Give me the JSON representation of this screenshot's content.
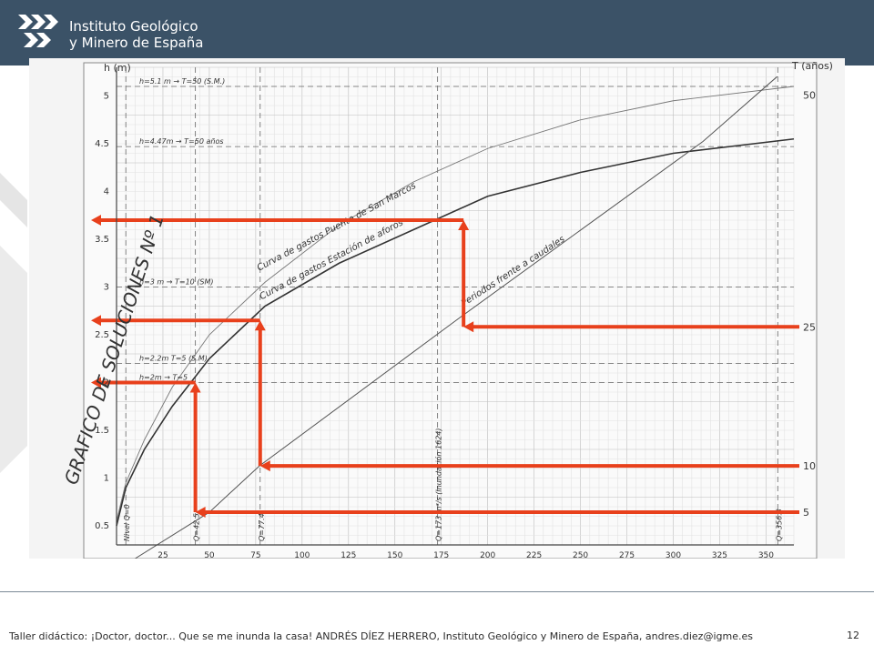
{
  "header": {
    "org_line1": "Instituto Geológico",
    "org_line2": "y Minero de España"
  },
  "footer": {
    "text": "Taller didáctico: ¡Doctor, doctor... Que se me inunda la casa! ANDRÉS DÍEZ HERRERO, Instituto Geológico y Minero de España, andres.diez@igme.es",
    "page": "12"
  },
  "colors": {
    "header_bg": "#3b5267",
    "arrows": "#e8401c",
    "grid": "#c9c9c9"
  },
  "chart_data": {
    "type": "line",
    "title": "GRAFICO DE SOLUCIONES Nº 1",
    "ylabel": "h (m)",
    "y2label": "T (años)",
    "xlim": [
      0,
      365
    ],
    "ylim": [
      0.3,
      5.3
    ],
    "y2lim": [
      0,
      53
    ],
    "x_ticks": [
      "25",
      "50",
      "75",
      "100",
      "125",
      "150",
      "175",
      "200",
      "225",
      "250",
      "275",
      "300",
      "325",
      "350"
    ],
    "y_ticks": [
      "0.5",
      "1",
      "1.5",
      "2",
      "2.5",
      "3",
      "3.5",
      "4",
      "4.5",
      "5"
    ],
    "y2_ticks": [
      "5",
      "10",
      "25",
      "50"
    ],
    "series": [
      {
        "name": "Curva de gastos Puente de San Marcos",
        "points": [
          [
            0,
            0.55
          ],
          [
            5,
            0.95
          ],
          [
            15,
            1.4
          ],
          [
            30,
            1.95
          ],
          [
            50,
            2.5
          ],
          [
            80,
            3.05
          ],
          [
            120,
            3.65
          ],
          [
            160,
            4.1
          ],
          [
            200,
            4.45
          ],
          [
            250,
            4.75
          ],
          [
            300,
            4.95
          ],
          [
            365,
            5.1
          ]
        ]
      },
      {
        "name": "Curva de gastos Estación de aforos",
        "points": [
          [
            0,
            0.5
          ],
          [
            5,
            0.9
          ],
          [
            15,
            1.3
          ],
          [
            30,
            1.75
          ],
          [
            50,
            2.25
          ],
          [
            80,
            2.8
          ],
          [
            120,
            3.25
          ],
          [
            160,
            3.6
          ],
          [
            200,
            3.95
          ],
          [
            250,
            4.2
          ],
          [
            300,
            4.4
          ],
          [
            365,
            4.55
          ]
        ]
      },
      {
        "name": "Periodos frente a caudales",
        "points": [
          [
            10,
            0
          ],
          [
            50,
            5
          ],
          [
            77,
            10
          ],
          [
            185,
            26
          ],
          [
            316,
            45
          ],
          [
            356,
            52
          ]
        ]
      }
    ],
    "annotations": [
      {
        "text": "h=5.1 m → T=50 (S.M.)",
        "y": 5.1
      },
      {
        "text": "h=4.47m → T=50 años",
        "y": 4.47
      },
      {
        "text": "h=3 m → T=10 (SM)",
        "y": 3.0
      },
      {
        "text": "h=2.2m T=5 (S.M)",
        "y": 2.2
      },
      {
        "text": "h=2m → T=5",
        "y": 2.0
      },
      {
        "text": "Q=42.5",
        "x": 42.5
      },
      {
        "text": "Q=77.4",
        "x": 77.4
      },
      {
        "text": "Q=173 m³/s (Inundación 1624)",
        "x": 173
      },
      {
        "text": "Q=356.3",
        "x": 356.3
      },
      {
        "text": "Nivel Q=0",
        "x": 5
      }
    ],
    "arrows": [
      {
        "period": 5,
        "q": 42.5,
        "h": 2.0
      },
      {
        "period": 10,
        "q": 77.4,
        "h": 2.65
      },
      {
        "period": 25,
        "q": 187,
        "h": 3.7
      }
    ]
  }
}
